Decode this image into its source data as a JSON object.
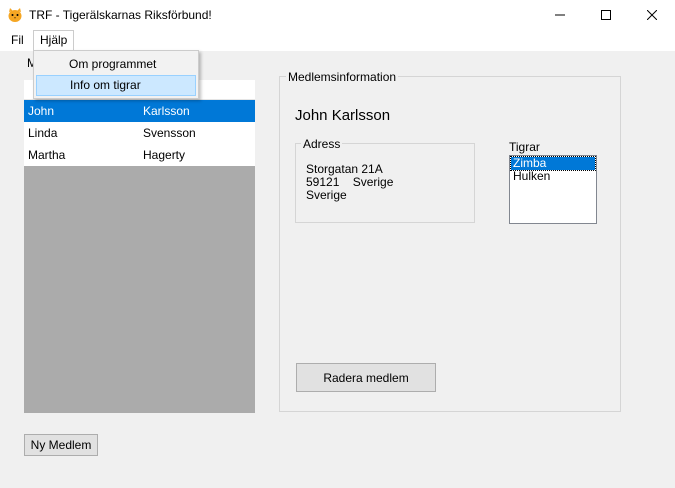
{
  "window": {
    "title": "TRF - Tigerälskarnas Riksförbund!",
    "icon": "cat-icon"
  },
  "menu": {
    "items": [
      "Fil",
      "Hjälp"
    ],
    "open_menu": "Hjälp",
    "dropdown": [
      "Om programmet",
      "Info om tigrar"
    ],
    "highlighted": "Info om tigrar"
  },
  "member_list": {
    "label": "M",
    "rows": [
      {
        "first": "John",
        "last": "Karlsson",
        "selected": true
      },
      {
        "first": "Linda",
        "last": "Svensson",
        "selected": false
      },
      {
        "first": "Martha",
        "last": "Hagerty",
        "selected": false
      }
    ]
  },
  "member_info": {
    "legend": "Medlemsinformation",
    "name": "John Karlsson",
    "address": {
      "legend": "Adress",
      "line1": "Storgatan 21A",
      "line2": "59121    Sverige",
      "line3": "Sverige"
    },
    "tigers": {
      "label": "Tigrar",
      "items": [
        "Zimba",
        "Hulken"
      ],
      "selected": "Zimba"
    },
    "delete_button": "Radera medlem"
  },
  "new_member_button": "Ny Medlem",
  "colors": {
    "selection": "#0078d7",
    "menu_highlight": "#cce8ff",
    "list_empty_area": "#ababab"
  }
}
